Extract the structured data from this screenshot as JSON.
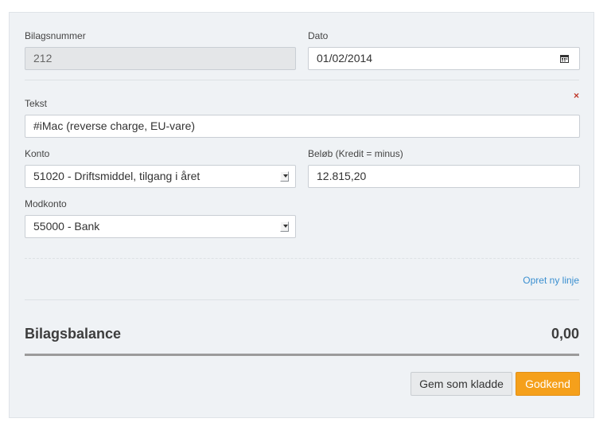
{
  "form": {
    "voucher_number": {
      "label": "Bilagsnummer",
      "value": "212"
    },
    "date": {
      "label": "Dato",
      "value": "01/02/2014"
    },
    "line": {
      "text": {
        "label": "Tekst",
        "value": "#iMac (reverse charge, EU-vare)"
      },
      "account": {
        "label": "Konto",
        "value": "51020 - Driftsmiddel, tilgang i året"
      },
      "amount": {
        "label": "Beløb (Kredit = minus)",
        "value": "12.815,20"
      },
      "contra_account": {
        "label": "Modkonto",
        "value": "55000 - Bank"
      },
      "remove_glyph": "×"
    },
    "add_line_link": "Opret ny linje",
    "balance": {
      "label": "Bilagsbalance",
      "value": "0,00"
    },
    "buttons": {
      "save_draft": "Gem som kladde",
      "approve": "Godkend"
    }
  },
  "colors": {
    "primary_button": "#f5a01b",
    "link": "#3a8fd0",
    "remove": "#c0392b"
  },
  "icons": [
    "calendar-icon",
    "select-arrow-icon",
    "remove-icon"
  ]
}
